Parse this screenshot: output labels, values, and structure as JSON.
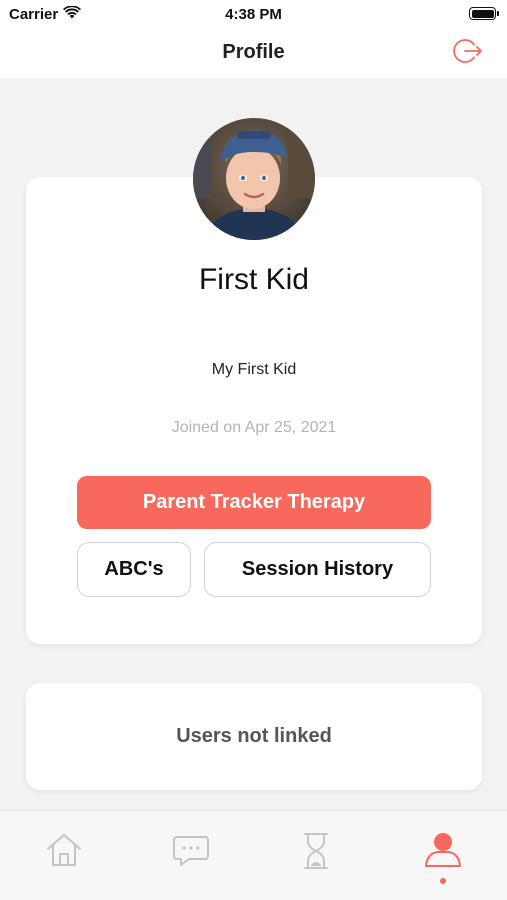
{
  "status_bar": {
    "carrier": "Carrier",
    "time": "4:38 PM",
    "wifi_icon": "wifi-icon",
    "battery_icon": "battery-icon"
  },
  "nav": {
    "title": "Profile",
    "logout_icon": "logout-icon"
  },
  "profile": {
    "name": "First Kid",
    "subtitle": "My First Kid",
    "joined": "Joined on Apr 25, 2021",
    "avatar": "child-avatar-photo"
  },
  "actions": {
    "primary_label": "Parent Tracker Therapy",
    "abc_label": "ABC's",
    "history_label": "Session History"
  },
  "linked": {
    "message": "Users not linked"
  },
  "tab_bar": {
    "items": [
      {
        "icon": "home-icon",
        "active": false
      },
      {
        "icon": "chat-icon",
        "active": false
      },
      {
        "icon": "hourglass-icon",
        "active": false
      },
      {
        "icon": "profile-icon",
        "active": true
      }
    ]
  },
  "colors": {
    "accent": "#f8685d",
    "background": "#f2f2f2",
    "muted_text": "#b3b3b8",
    "inactive_icon": "#c4c4c8"
  }
}
